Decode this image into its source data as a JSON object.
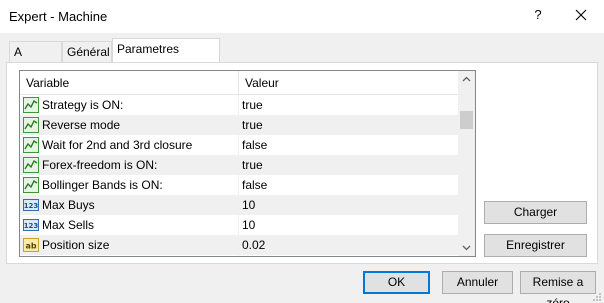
{
  "window": {
    "title": "Expert - Machine",
    "help_label": "?"
  },
  "tabs": [
    {
      "label": "A propos",
      "active": false
    },
    {
      "label": "Général",
      "active": false
    },
    {
      "label": "Parametres d'entrée",
      "active": true
    }
  ],
  "table": {
    "headers": {
      "variable": "Variable",
      "value": "Valeur"
    },
    "rows": [
      {
        "icon": "chart-line-icon",
        "name": "Strategy is ON:",
        "value": "true"
      },
      {
        "icon": "chart-line-icon",
        "name": "Reverse mode",
        "value": "true"
      },
      {
        "icon": "chart-line-icon",
        "name": "Wait for 2nd and 3rd closure",
        "value": "false"
      },
      {
        "icon": "chart-line-icon",
        "name": "Forex-freedom is ON:",
        "value": "true"
      },
      {
        "icon": "chart-line-icon",
        "name": "Bollinger Bands is ON:",
        "value": "false"
      },
      {
        "icon": "integer-123-icon",
        "name": "Max Buys",
        "value": "10"
      },
      {
        "icon": "integer-123-icon",
        "name": "Max Sells",
        "value": "10"
      },
      {
        "icon": "text-ab-icon",
        "name": "Position size",
        "value": "0.02"
      }
    ]
  },
  "side_buttons": {
    "load": "Charger",
    "save": "Enregistrer"
  },
  "footer_buttons": {
    "ok": "OK",
    "cancel": "Annuler",
    "reset": "Remise a zéro"
  },
  "colors": {
    "accent": "#0078d7",
    "icon_green": "#3a9a3a",
    "icon_blue": "#2f6fb5",
    "icon_yellow": "#e8c24a"
  }
}
